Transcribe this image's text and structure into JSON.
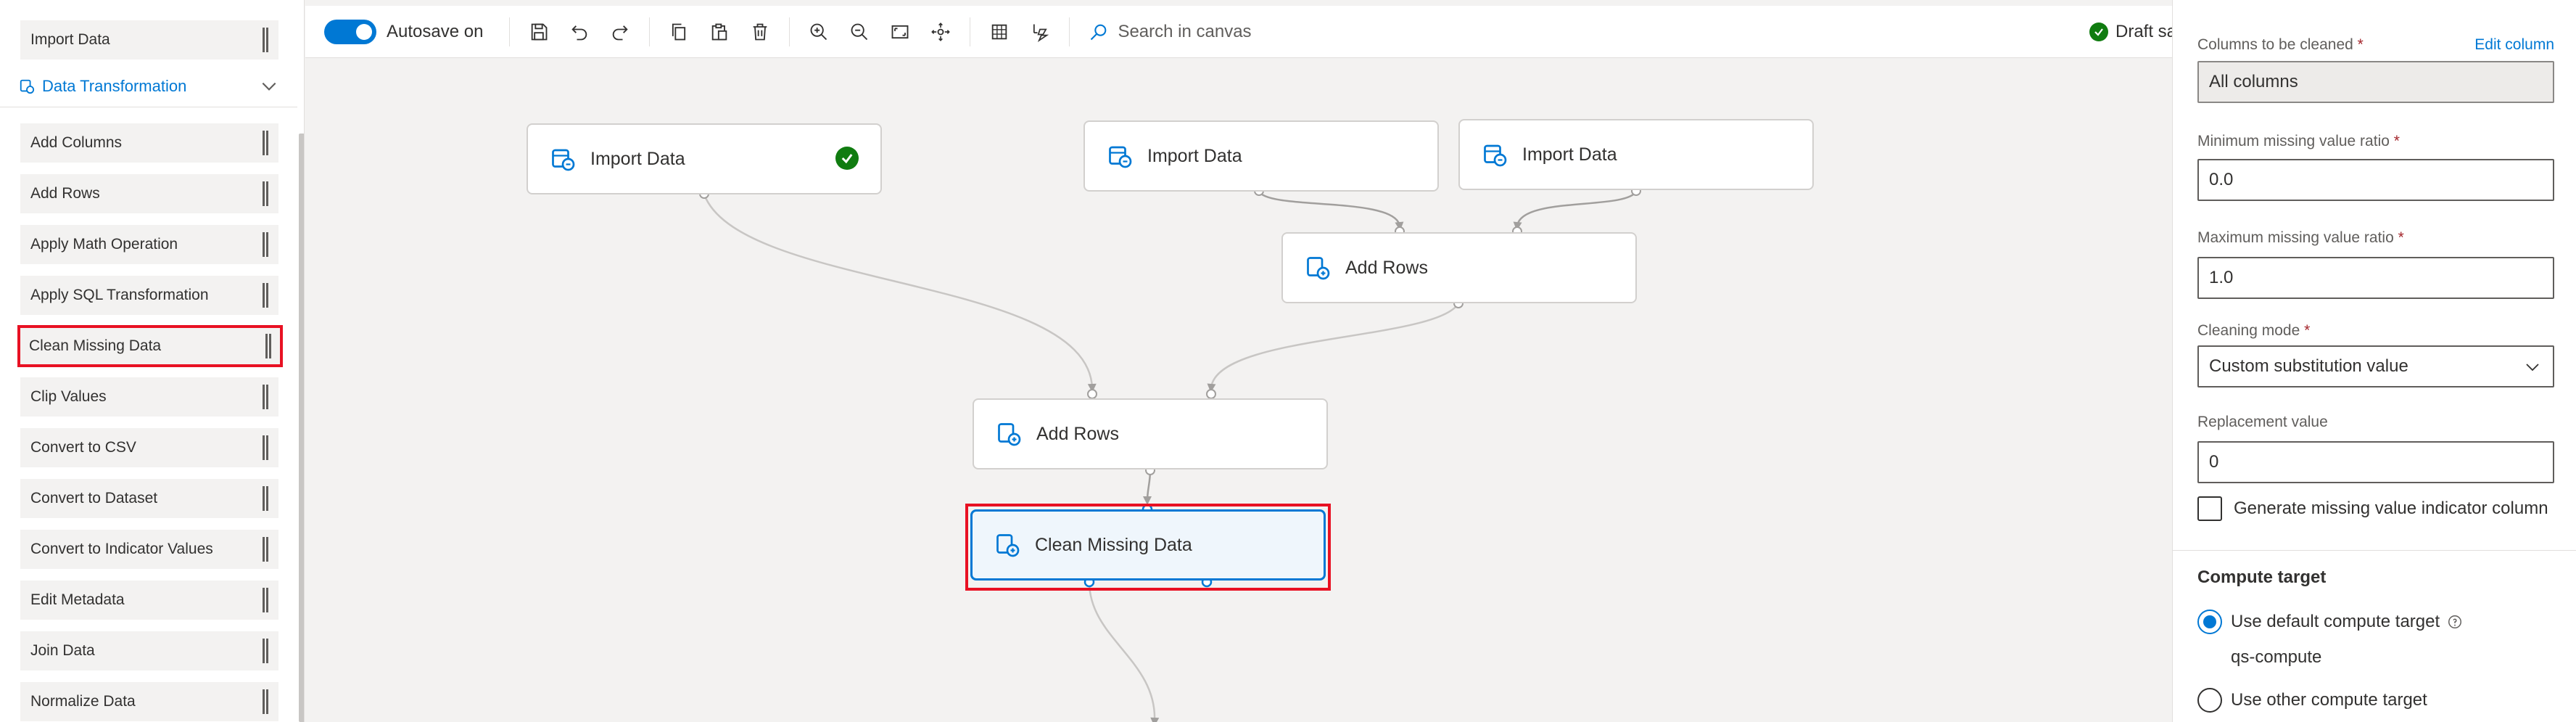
{
  "palette": {
    "top_item": "Import Data",
    "category": "Data Transformation",
    "items": [
      "Add Columns",
      "Add Rows",
      "Apply Math Operation",
      "Apply SQL Transformation",
      "Clean Missing Data",
      "Clip Values",
      "Convert to CSV",
      "Convert to Dataset",
      "Convert to Indicator Values",
      "Edit Metadata",
      "Join Data",
      "Normalize Data"
    ],
    "highlighted_item": "Clean Missing Data"
  },
  "toolbar": {
    "autosave_label": "Autosave on",
    "autosave_on": true,
    "search_placeholder": "Search in canvas",
    "draft_status": "Draft sa"
  },
  "canvas": {
    "nodes": {
      "import_1": "Import Data",
      "import_2": "Import Data",
      "import_3": "Import Data",
      "add_rows_1": "Add Rows",
      "add_rows_2": "Add Rows",
      "clean_missing": "Clean Missing Data"
    },
    "import_1_status": "completed",
    "selected_node": "Clean Missing Data"
  },
  "properties": {
    "columns_label": "Columns to be cleaned",
    "edit_column_link": "Edit column",
    "columns_value": "All columns",
    "min_ratio_label": "Minimum missing value ratio",
    "min_ratio_value": "0.0",
    "max_ratio_label": "Maximum missing value ratio",
    "max_ratio_value": "1.0",
    "cleaning_mode_label": "Cleaning mode",
    "cleaning_mode_value": "Custom substitution value",
    "replacement_label": "Replacement value",
    "replacement_value": "0",
    "indicator_checkbox_label": "Generate missing value indicator column",
    "indicator_checked": false,
    "required_marker": "*",
    "compute_title": "Compute target",
    "default_compute_label": "Use default compute target",
    "default_compute_name": "qs-compute",
    "other_compute_label": "Use other compute target",
    "selected_compute": "default"
  },
  "colors": {
    "accent": "#0078d4",
    "success": "#107c10",
    "highlight": "#e81123",
    "required": "#a4262c"
  },
  "icons": {
    "toolbar": [
      "save-icon",
      "undo-icon",
      "redo-icon",
      "copy-icon",
      "paste-icon",
      "delete-icon",
      "zoom-in-icon",
      "zoom-out-icon",
      "fit-to-screen-icon",
      "pan-icon",
      "grid-icon",
      "auto-layout-icon",
      "search-icon"
    ],
    "node": "dataset-module-icon",
    "status": "check-circle-icon"
  }
}
